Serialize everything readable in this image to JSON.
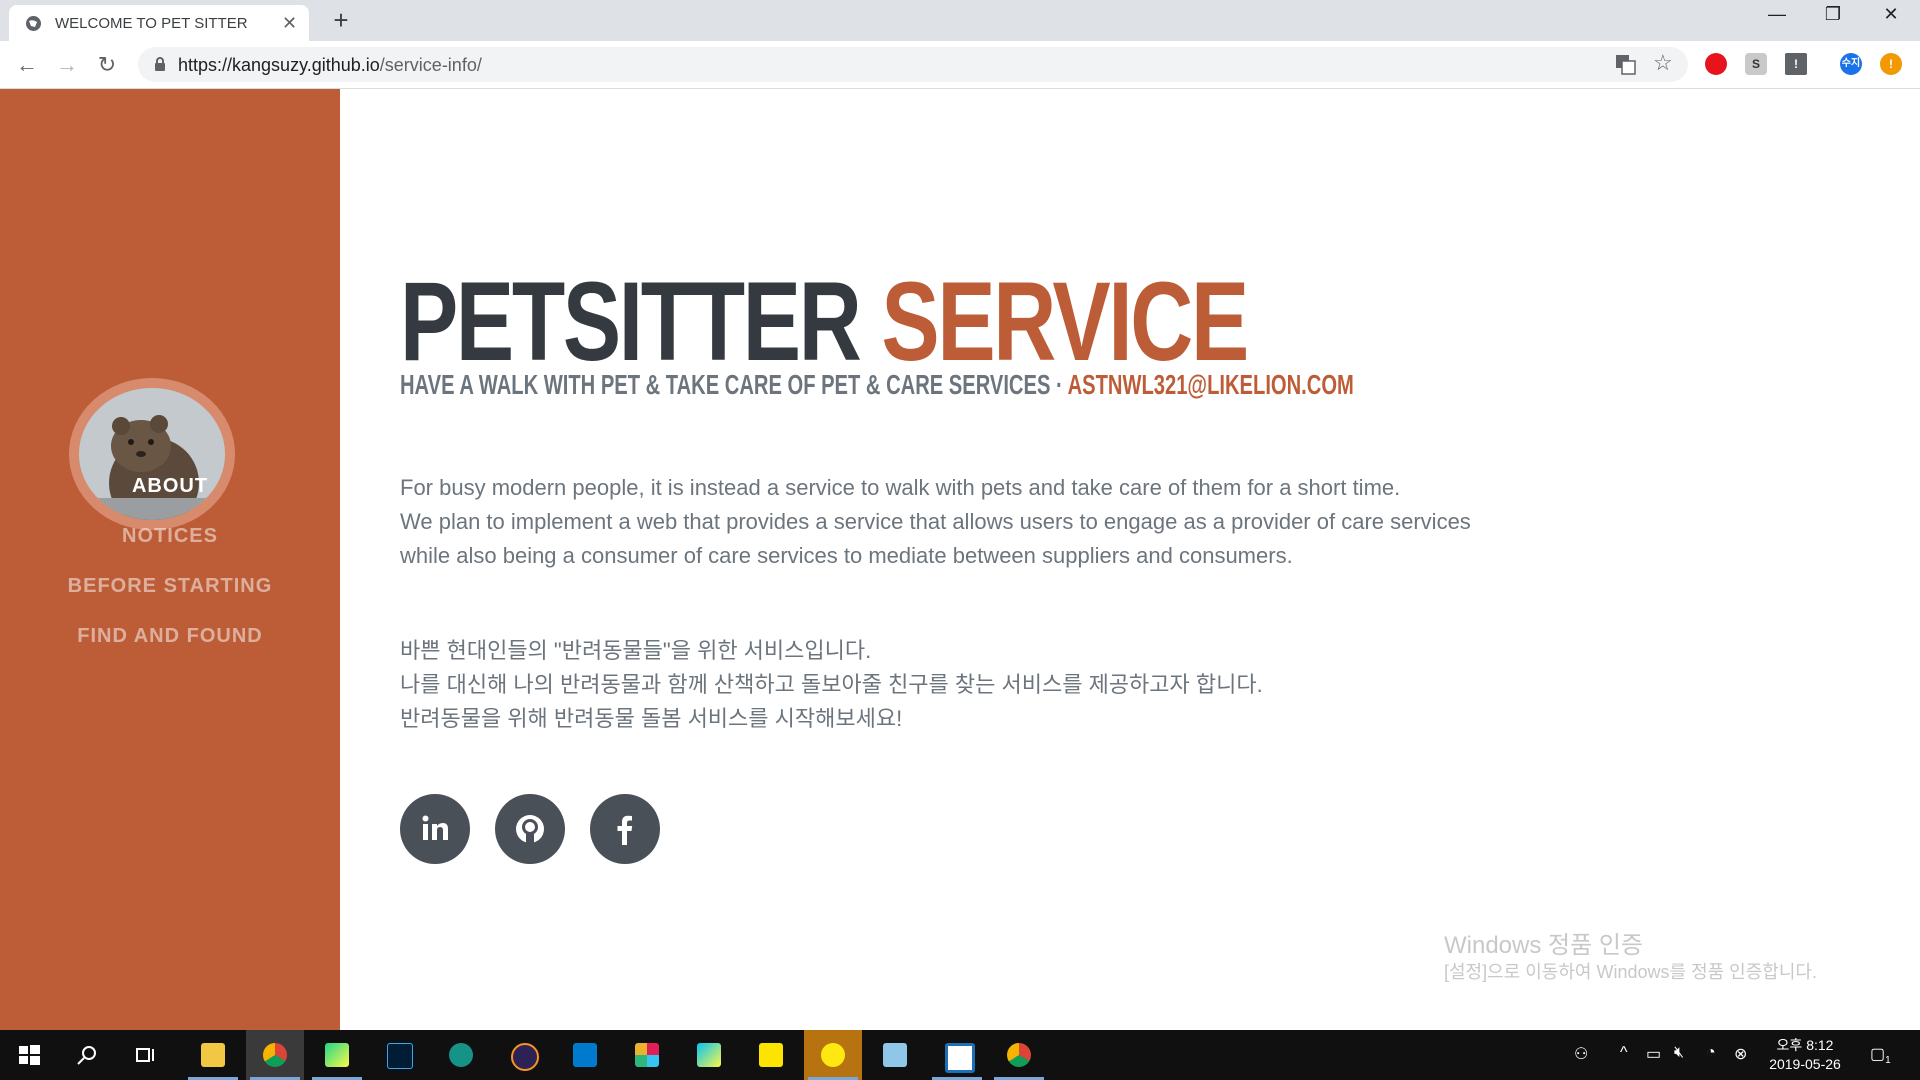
{
  "browser": {
    "tab_title": "WELCOME TO PET SITTER",
    "close_glyph": "✕",
    "newtab_glyph": "+",
    "url_host": "https://kangsuzy.github.io",
    "url_path": "/service-info/",
    "window_controls": {
      "minimize": "—",
      "maximize": "❐",
      "close": "✕"
    },
    "nav": {
      "back": "←",
      "forward": "→",
      "reload": "↻"
    },
    "star": "☆"
  },
  "sidebar": {
    "color": "#bd5d38",
    "nav_items": [
      {
        "label": "ABOUT",
        "active": true
      },
      {
        "label": "NOTICES",
        "active": false
      },
      {
        "label": "BEFORE STARTING",
        "active": false
      },
      {
        "label": "FIND AND FOUND",
        "active": false
      }
    ]
  },
  "main": {
    "title_part1": "PETSITTER",
    "title_part2": "SERVICE",
    "subtitle_text": "HAVE A WALK WITH PET & TAKE CARE OF PET & CARE SERVICES · ",
    "subtitle_email": "ASTNWL321@LIKELION.COM",
    "english_lines": [
      "For busy modern people, it is instead a service to walk with pets and take care of them for a short time.",
      "We plan to implement a web that provides a service that allows users to engage as a provider of care services",
      "while also being a consumer of care services to mediate between suppliers and consumers."
    ],
    "korean_lines": [
      "바쁜 현대인들의 \"반려동물들\"을 위한 서비스입니다.",
      "나를 대신해 나의 반려동물과 함께 산책하고 돌보아줄 친구를 찾는 서비스를 제공하고자 합니다.",
      "반려동물을 위해 반려동물 돌봄 서비스를 시작해보세요!"
    ],
    "social_icons": [
      "linkedin-icon",
      "github-icon",
      "facebook-icon"
    ]
  },
  "watermark": {
    "line1": "Windows 정품 인증",
    "line2": "[설정]으로 이동하여 Windows를 정품 인증합니다."
  },
  "taskbar": {
    "clock_line1": "오후 8:12",
    "clock_line2": "2019-05-26",
    "notification_count": "1",
    "apps": [
      "start-icon",
      "search-icon",
      "task-view-icon",
      "file-explorer-icon",
      "chrome-icon",
      "pycharm-icon",
      "photoshop-icon",
      "gitkraken-icon",
      "eclipse-icon",
      "vscode-icon",
      "slack-icon",
      "webstorm-icon",
      "sticky-notes-icon",
      "kakaotalk-icon",
      "notepad-icon",
      "app-icon",
      "chrome-icon"
    ]
  }
}
